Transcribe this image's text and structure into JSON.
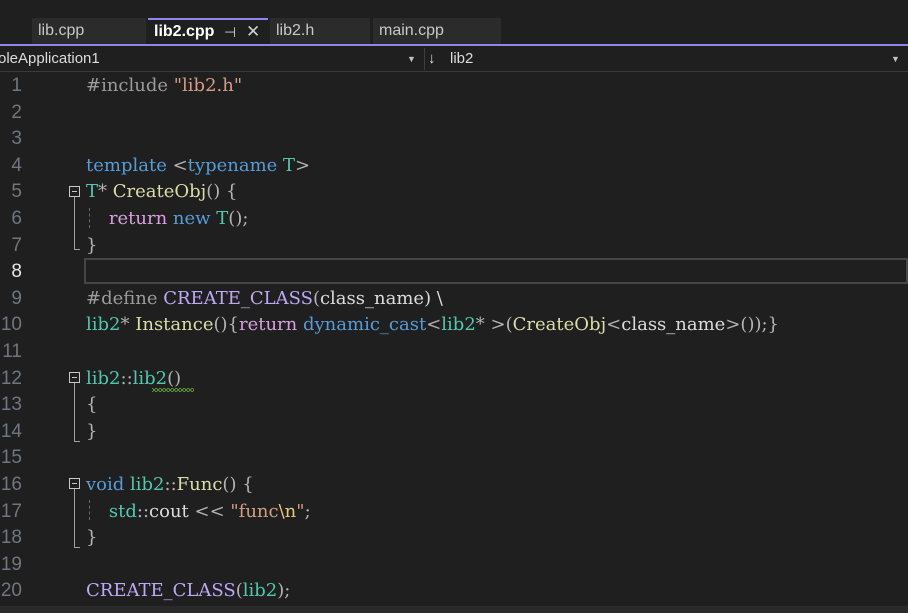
{
  "tabs": [
    {
      "label": "lib.cpp",
      "active": false
    },
    {
      "label": "lib2.cpp",
      "active": true,
      "pin_icon": "⊣",
      "close_icon": "✕"
    },
    {
      "label": "lib2.h",
      "active": false
    },
    {
      "label": "main.cpp",
      "active": false
    }
  ],
  "navbar": {
    "project": "oleApplication1",
    "scope_arrow": "↓",
    "scope": "lib2",
    "dropdown_glyph": "▼"
  },
  "colors": {
    "accent": "#9184ee",
    "background": "#1f1f1f",
    "keyword": "#569cd6",
    "control_keyword": "#d8a0df",
    "type": "#4ec9b0",
    "function": "#dcdcaa",
    "string": "#d69d85",
    "macro": "#bea8f7",
    "preprocessor": "#9b9b9b",
    "escape": "#e8c97a",
    "error_squiggle": "#6bb63a"
  },
  "current_line": 8,
  "editor": {
    "lines": [
      {
        "n": "1",
        "tokens": [
          {
            "t": "#include ",
            "c": "#9b9b9b"
          },
          {
            "t": "\"lib2.h\"",
            "c": "#d69d85"
          }
        ]
      },
      {
        "n": "2",
        "tokens": []
      },
      {
        "n": "3",
        "tokens": []
      },
      {
        "n": "4",
        "tokens": [
          {
            "t": "template ",
            "c": "#569cd6"
          },
          {
            "t": "<",
            "c": "#b4b4b4"
          },
          {
            "t": "typename ",
            "c": "#569cd6"
          },
          {
            "t": "T",
            "c": "#4ec9b0"
          },
          {
            "t": ">",
            "c": "#b4b4b4"
          }
        ]
      },
      {
        "n": "5",
        "tokens": [
          {
            "t": "T",
            "c": "#4ec9b0"
          },
          {
            "t": "* ",
            "c": "#b4b4b4"
          },
          {
            "t": "CreateObj",
            "c": "#dcdcaa"
          },
          {
            "t": "() {",
            "c": "#b4b4b4"
          }
        ]
      },
      {
        "n": "6",
        "tokens": [
          {
            "t": "    ",
            "c": "#dcdcdc"
          },
          {
            "t": "return ",
            "c": "#d8a0df"
          },
          {
            "t": "new ",
            "c": "#569cd6"
          },
          {
            "t": "T",
            "c": "#4ec9b0"
          },
          {
            "t": "();",
            "c": "#b4b4b4"
          }
        ]
      },
      {
        "n": "7",
        "tokens": [
          {
            "t": "}",
            "c": "#b4b4b4"
          }
        ]
      },
      {
        "n": "8",
        "tokens": []
      },
      {
        "n": "9",
        "tokens": [
          {
            "t": "#define ",
            "c": "#9b9b9b"
          },
          {
            "t": "CREATE_CLASS",
            "c": "#bea8f7"
          },
          {
            "t": "(",
            "c": "#b4b4b4"
          },
          {
            "t": "class_name",
            "c": "#dcdcdc"
          },
          {
            "t": ") \\",
            "c": "#dcdcdc"
          }
        ]
      },
      {
        "n": "10",
        "tokens": [
          {
            "t": "lib2",
            "c": "#4ec9b0"
          },
          {
            "t": "* ",
            "c": "#b4b4b4"
          },
          {
            "t": "Instance",
            "c": "#dcdcaa"
          },
          {
            "t": "(){",
            "c": "#b4b4b4"
          },
          {
            "t": "return ",
            "c": "#d8a0df"
          },
          {
            "t": "dynamic_cast",
            "c": "#569cd6"
          },
          {
            "t": "<",
            "c": "#b4b4b4"
          },
          {
            "t": "lib2",
            "c": "#4ec9b0"
          },
          {
            "t": "* ",
            "c": "#b4b4b4"
          },
          {
            "t": ">(",
            "c": "#b4b4b4"
          },
          {
            "t": "CreateObj",
            "c": "#dcdcaa"
          },
          {
            "t": "<",
            "c": "#b4b4b4"
          },
          {
            "t": "class_name",
            "c": "#dcdcdc"
          },
          {
            "t": ">());}",
            "c": "#b4b4b4"
          }
        ]
      },
      {
        "n": "11",
        "tokens": []
      },
      {
        "n": "12",
        "tokens": [
          {
            "t": "lib2",
            "c": "#4ec9b0"
          },
          {
            "t": "::",
            "c": "#b4b4b4"
          },
          {
            "t": "lib2",
            "c": "#4ec9b0"
          },
          {
            "t": "()",
            "c": "#b4b4b4"
          }
        ]
      },
      {
        "n": "13",
        "tokens": [
          {
            "t": "{",
            "c": "#b4b4b4"
          }
        ]
      },
      {
        "n": "14",
        "tokens": [
          {
            "t": "}",
            "c": "#b4b4b4"
          }
        ]
      },
      {
        "n": "15",
        "tokens": []
      },
      {
        "n": "16",
        "tokens": [
          {
            "t": "void ",
            "c": "#569cd6"
          },
          {
            "t": "lib2",
            "c": "#4ec9b0"
          },
          {
            "t": "::",
            "c": "#b4b4b4"
          },
          {
            "t": "Func",
            "c": "#dcdcaa"
          },
          {
            "t": "() {",
            "c": "#b4b4b4"
          }
        ]
      },
      {
        "n": "17",
        "tokens": [
          {
            "t": "    ",
            "c": "#dcdcdc"
          },
          {
            "t": "std",
            "c": "#4ec9b0"
          },
          {
            "t": "::",
            "c": "#b4b4b4"
          },
          {
            "t": "cout ",
            "c": "#dcdcdc"
          },
          {
            "t": "<< ",
            "c": "#b4b4b4"
          },
          {
            "t": "\"func",
            "c": "#d69d85"
          },
          {
            "t": "\\n",
            "c": "#e8c97a"
          },
          {
            "t": "\"",
            "c": "#d69d85"
          },
          {
            "t": ";",
            "c": "#b4b4b4"
          }
        ]
      },
      {
        "n": "18",
        "tokens": [
          {
            "t": "}",
            "c": "#b4b4b4"
          }
        ]
      },
      {
        "n": "19",
        "tokens": []
      },
      {
        "n": "20",
        "tokens": [
          {
            "t": "CREATE_CLASS",
            "c": "#bea8f7"
          },
          {
            "t": "(",
            "c": "#b4b4b4"
          },
          {
            "t": "lib2",
            "c": "#4ec9b0"
          },
          {
            "t": ");",
            "c": "#b4b4b4"
          }
        ]
      }
    ]
  }
}
